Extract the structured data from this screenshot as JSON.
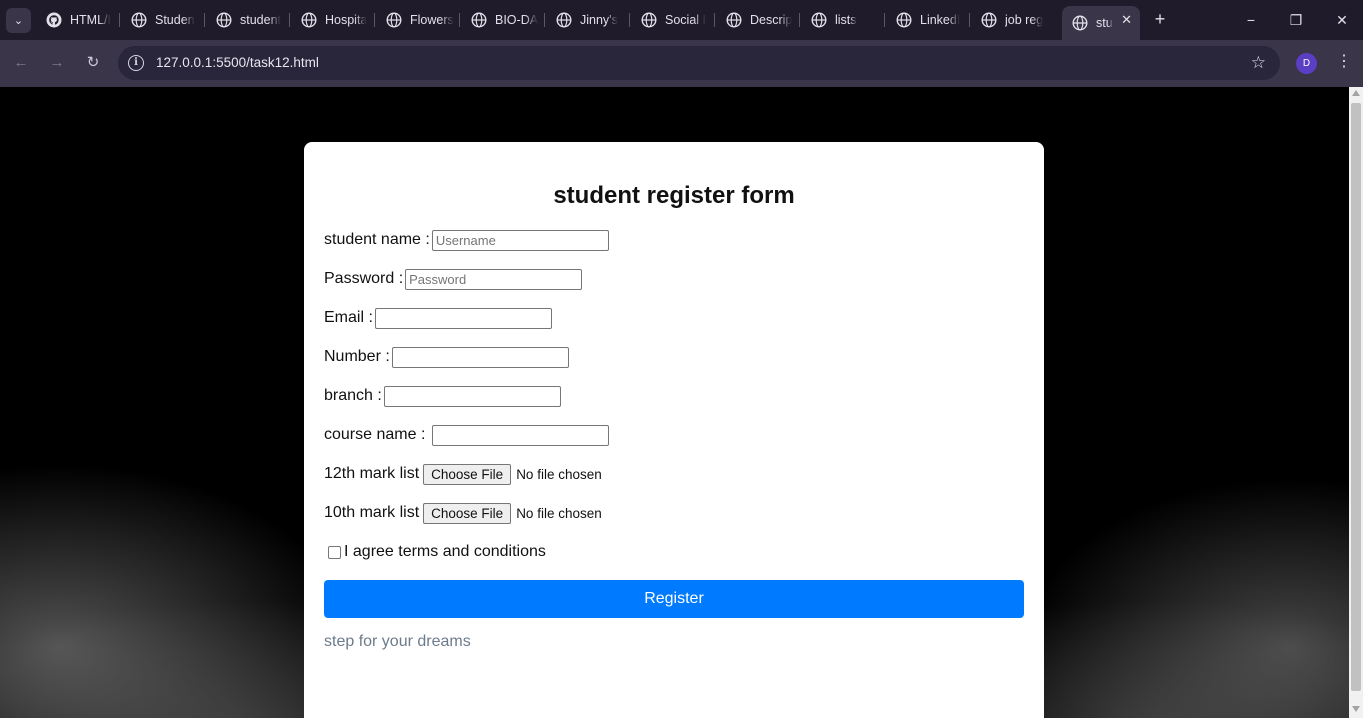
{
  "browser": {
    "tabs": [
      {
        "label": "HTML/I",
        "icon": "github-icon"
      },
      {
        "label": "Studen",
        "icon": "globe-icon"
      },
      {
        "label": "student",
        "icon": "globe-icon"
      },
      {
        "label": "Hospita",
        "icon": "globe-icon"
      },
      {
        "label": "Flowers",
        "icon": "globe-icon"
      },
      {
        "label": "BIO-DA",
        "icon": "globe-icon"
      },
      {
        "label": "Jinny's",
        "icon": "globe-icon"
      },
      {
        "label": "Social I",
        "icon": "globe-icon"
      },
      {
        "label": "Descrip",
        "icon": "globe-icon"
      },
      {
        "label": "lists",
        "icon": "globe-icon"
      },
      {
        "label": "LinkedI",
        "icon": "globe-icon"
      },
      {
        "label": "job reg",
        "icon": "globe-icon"
      },
      {
        "label": "stu",
        "icon": "globe-icon",
        "active": true
      }
    ],
    "new_tab": "+",
    "window_controls": {
      "minimize": "−",
      "restore": "❐",
      "close": "✕"
    },
    "address": {
      "host": "127.0.0.1",
      "rest": ":5500/task12.html"
    },
    "profile_initial": "D"
  },
  "form": {
    "title": "student register form",
    "fields": {
      "student_name": {
        "label": "student name :",
        "placeholder": "Username",
        "value": ""
      },
      "password": {
        "label": "Password :",
        "placeholder": "Password",
        "value": ""
      },
      "email": {
        "label": "Email :",
        "placeholder": "",
        "value": ""
      },
      "number": {
        "label": "Number :",
        "placeholder": "",
        "value": ""
      },
      "branch": {
        "label": "branch :",
        "placeholder": "",
        "value": ""
      },
      "course_name": {
        "label": "course name : ",
        "placeholder": "",
        "value": ""
      }
    },
    "files": {
      "mark12": {
        "label": "12th mark list",
        "button": "Choose File",
        "status": "No file chosen"
      },
      "mark10": {
        "label": "10th mark list",
        "button": "Choose File",
        "status": "No file chosen"
      }
    },
    "agree": {
      "label": "I agree terms and conditions",
      "checked": false
    },
    "register_label": "Register",
    "tagline": "step for your dreams"
  },
  "colors": {
    "accent": "#007bff",
    "chrome_bg": "#1f1b2a",
    "toolbar_bg": "#3a3548",
    "tagline": "#6c7b8b"
  }
}
